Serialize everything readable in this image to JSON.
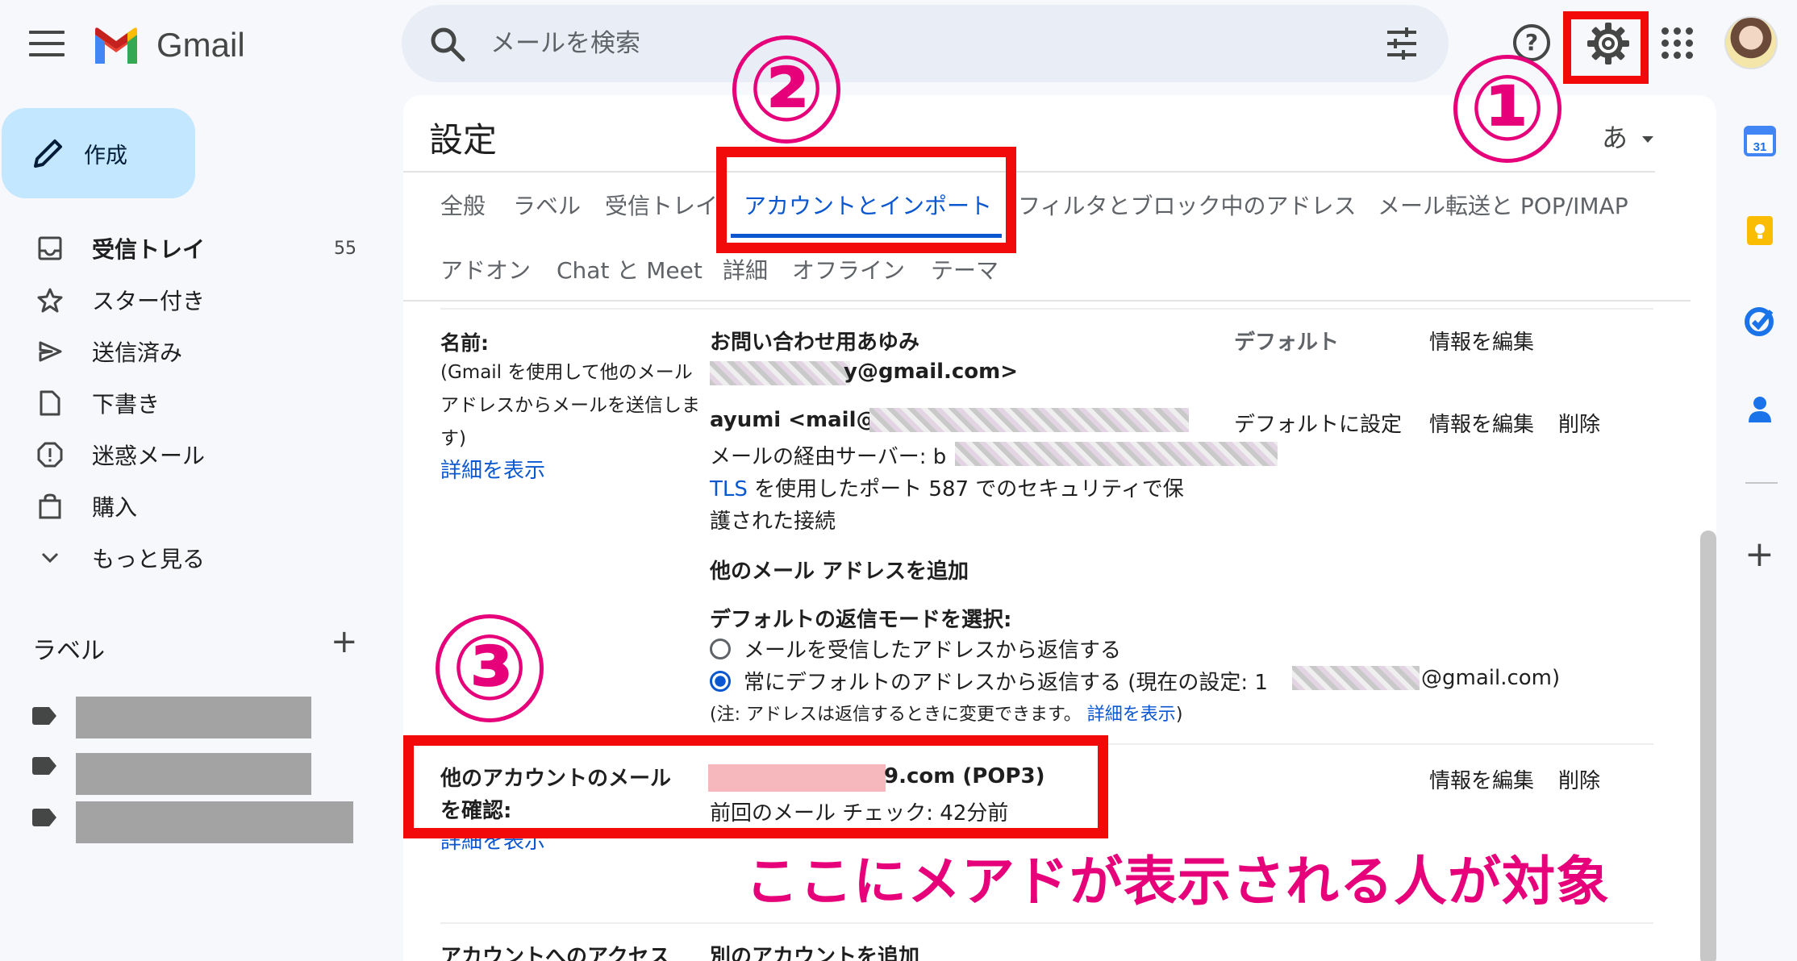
{
  "header": {
    "app_name": "Gmail",
    "search_placeholder": "メールを検索",
    "help_icon_text": "?"
  },
  "sidebar": {
    "compose_label": "作成",
    "items": [
      {
        "label": "受信トレイ",
        "count": "55",
        "icon": "inbox-icon"
      },
      {
        "label": "スター付き",
        "count": "",
        "icon": "star-icon"
      },
      {
        "label": "送信済み",
        "count": "",
        "icon": "send-icon"
      },
      {
        "label": "下書き",
        "count": "",
        "icon": "draft-icon"
      },
      {
        "label": "迷惑メール",
        "count": "",
        "icon": "spam-icon"
      },
      {
        "label": "購入",
        "count": "",
        "icon": "purchase-icon"
      },
      {
        "label": "もっと見る",
        "count": "",
        "icon": "chevron-down-icon"
      }
    ],
    "labels_heading": "ラベル",
    "labels_add": "+"
  },
  "settings": {
    "title": "設定",
    "lang_button": "あ",
    "tabs_row1": [
      "全般",
      "ラベル",
      "受信トレイ",
      "アカウントとインポート",
      "フィルタとブロック中のアドレス",
      "メール転送と POP/IMAP"
    ],
    "tabs_row2": [
      "アドオン",
      "Chat と Meet",
      "詳細",
      "オフライン",
      "テーマ"
    ],
    "active_tab": "アカウントとインポート",
    "send_as": {
      "label": "名前:",
      "help_line1": "(Gmail を使用して他のメール",
      "help_line2": "アドレスからメールを送信しま",
      "help_line3": "す)",
      "details_link": "詳細を表示",
      "primary_name": "お問い合わせ用あゆみ",
      "primary_email_suffix": "y@gmail.com>",
      "primary_status": "デフォルト",
      "primary_edit": "情報を編集",
      "alias_name": "ayumi <mail@b",
      "alias_server": "メールの経由サーバー: b",
      "alias_tls_link": "TLS",
      "alias_tls_line1": " を使用したポート 587 でのセキュリティで保",
      "alias_tls_line2": "護された接続",
      "alias_make_default": "デフォルトに設定",
      "alias_edit": "情報を編集",
      "alias_delete": "削除",
      "add_address": "他のメール アドレスを追加",
      "reply_mode_label": "デフォルトの返信モードを選択:",
      "reply_option1": "メールを受信したアドレスから返信する",
      "reply_option2": "常にデフォルトのアドレスから返信する (現在の設定: 1",
      "reply_option2_suffix": "@gmail.com)",
      "note_text": "(注: アドレスは返信するときに変更できます。",
      "note_link": "詳細を表示",
      "note_close": ")"
    },
    "check_mail": {
      "label_line1": "他のアカウントのメール",
      "label_line2": "を確認:",
      "account_suffix": "9.com (POP3)",
      "last_check": "前回のメール チェック: 42分前",
      "edit": "情報を編集",
      "delete": "削除",
      "details_link": "詳細を表示"
    },
    "access": {
      "label": "アカウントへのアクセス",
      "add_link": "別のアカウントを追加"
    }
  },
  "annotations": {
    "step1": "①",
    "step2": "②",
    "step3": "③",
    "caption": "ここにメアドが表示される人が対象"
  },
  "colors": {
    "accent": "#0b57d0",
    "highlight_box": "#f20a0a",
    "annotation_pink": "#e6007a",
    "compose_bg": "#c2e7ff"
  }
}
